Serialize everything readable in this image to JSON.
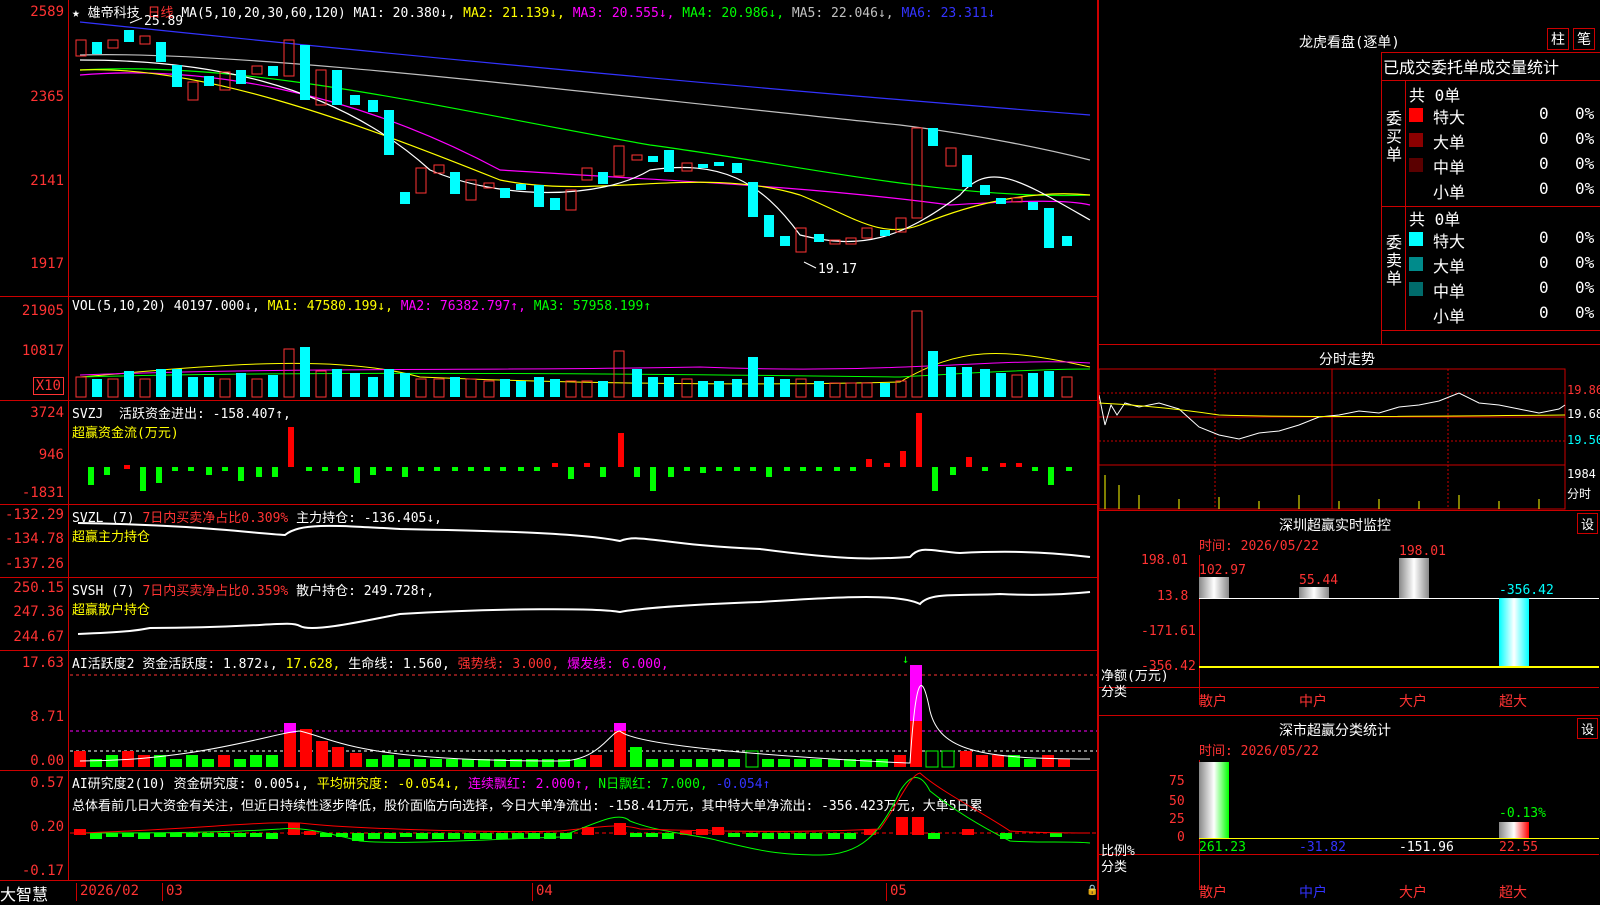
{
  "stock": {
    "name": "雄帝科技",
    "period": "日线",
    "ma_params": "MA(5,10,20,30,60,120)",
    "ma_values": [
      {
        "label": "MA1: 20.380↓,",
        "color": "#ffffff"
      },
      {
        "label": "MA2: 21.139↓,",
        "color": "#ffff00"
      },
      {
        "label": "MA3: 20.555↓,",
        "color": "#ff00ff"
      },
      {
        "label": "MA4: 20.986↓,",
        "color": "#00ff00"
      },
      {
        "label": "MA5: 22.046↓,",
        "color": "#c0c0c0"
      },
      {
        "label": "MA6: 23.311↓",
        "color": "#3333ff"
      }
    ],
    "high_marker": "25.89",
    "low_marker": "19.17"
  },
  "axes": {
    "price": [
      "2589",
      "2365",
      "2141",
      "1917"
    ],
    "vol": [
      "21905",
      "10817"
    ],
    "vol_unit": "X10",
    "svzj": [
      "3724",
      "946",
      "-1831"
    ],
    "svzl": [
      "-132.29",
      "-134.78",
      "-137.26"
    ],
    "svsh": [
      "250.15",
      "247.36",
      "244.67"
    ],
    "active": [
      "17.63",
      "8.71",
      "0.00"
    ],
    "research": [
      "0.57",
      "0.20",
      "-0.17"
    ]
  },
  "volume": {
    "name": "VOL(5,10,20)",
    "value": "40197.000↓,",
    "ma1": "MA1: 47580.199↓,",
    "ma2": "MA2: 76382.797↑,",
    "ma3": "MA3: 57958.199↑"
  },
  "svzj": {
    "name": "SVZJ",
    "label": "活跃资金进出: -158.407↑,",
    "sub": "超赢资金流(万元)"
  },
  "svzl": {
    "name": "SVZL (7)",
    "ratio": "7日内买卖净占比0.309%",
    "label": "主力持仓: -136.405↓,",
    "sub": "超赢主力持仓"
  },
  "svsh": {
    "name": "SVSH (7)",
    "ratio": "7日内买卖净占比0.359%",
    "label": "散户持仓: 249.728↑,",
    "sub": "超赢散户持仓"
  },
  "active": {
    "name": "AI活跃度2",
    "a": "资金活跃度: 1.872↓,",
    "b": "17.628,",
    "c": "生命线: 1.560,",
    "d": "强势线: 3.000,",
    "e": "爆发线: 6.000,"
  },
  "research": {
    "name": "AI研究度2(10)",
    "a": "资金研究度: 0.005↓,",
    "b": "平均研究度: -0.054↓,",
    "c": "连续飘红: 2.000↑,",
    "d": "N日飘红: 7.000,",
    "e": "-0.054↑",
    "comment": "总体看前几日大资金有关注，但近日持续性逐步降低，股价面临方向选择，今日大单净流出: -158.41万元，其中特大单净流出: -356.423万元，大单5日累"
  },
  "timeline": {
    "logo": "大智慧",
    "labels": [
      "2026/02",
      "03",
      "04",
      "05"
    ]
  },
  "dragon": {
    "title": "龙虎看盘(逐单)",
    "btn1": "柱",
    "btn2": "笔",
    "stats_title": "已成交委托单成交量统计",
    "buy_side": "委买单",
    "sell_side": "委卖单",
    "buy_total": "共 0单",
    "sell_total": "共 0单",
    "buy_rows": [
      {
        "label": "特大",
        "count": "0",
        "pct": "0%",
        "color": "#ff0000"
      },
      {
        "label": "大单",
        "count": "0",
        "pct": "0%",
        "color": "#8b0000"
      },
      {
        "label": "中单",
        "count": "0",
        "pct": "0%",
        "color": "#5a0000"
      },
      {
        "label": "小单",
        "count": "0",
        "pct": "0%",
        "color": ""
      }
    ],
    "sell_rows": [
      {
        "label": "特大",
        "count": "0",
        "pct": "0%",
        "color": "#00ffff"
      },
      {
        "label": "大单",
        "count": "0",
        "pct": "0%",
        "color": "#008b8b"
      },
      {
        "label": "中单",
        "count": "0",
        "pct": "0%",
        "color": "#006b6b"
      },
      {
        "label": "小单",
        "count": "0",
        "pct": "0%",
        "color": ""
      }
    ]
  },
  "intraday": {
    "title": "分时走势",
    "y": [
      "19.86",
      "19.68",
      "19.50"
    ],
    "vol": "1984",
    "vol_unit": "分时"
  },
  "monitor": {
    "title": "深圳超赢实时监控",
    "set": "设",
    "time": "时间: 2026/05/22",
    "y": [
      "198.01",
      "13.8",
      "-171.61",
      "-356.42"
    ],
    "ylabel": "净额(万元)",
    "xlabel": "分类",
    "cats": [
      "散户",
      "中户",
      "大户",
      "超大"
    ],
    "values": [
      "102.97",
      "55.44",
      "198.01",
      "-356.42"
    ]
  },
  "classify": {
    "title": "深市超赢分类统计",
    "set": "设",
    "time": "时间: 2026/05/22",
    "y": [
      "75",
      "50",
      "25",
      "0"
    ],
    "ylabel": "比例%",
    "xlabel": "分类",
    "cats": [
      "散户",
      "中户",
      "大户",
      "超大"
    ],
    "values": [
      "261.23",
      "-31.82",
      "-151.96",
      "22.55"
    ],
    "pct": "-0.13%"
  }
}
